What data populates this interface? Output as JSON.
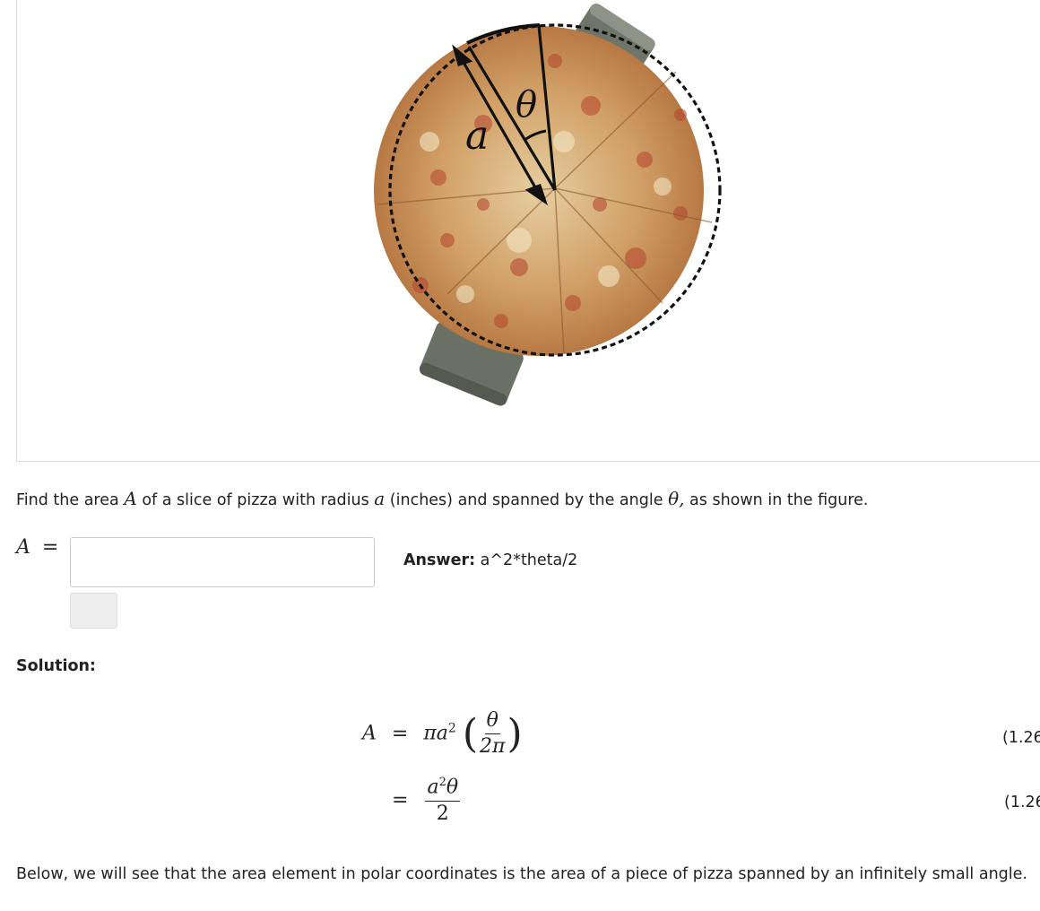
{
  "figure": {
    "label_radius": "a",
    "label_angle": "θ"
  },
  "question": {
    "text_1": "Find the area",
    "var_area": "A",
    "text_2": "of a slice of pizza with radius",
    "var_radius": "a",
    "text_3": "(inches) and spanned by the angle",
    "var_angle": "θ,",
    "text_4": "as shown in the figure."
  },
  "answer_form": {
    "lhs": "A",
    "equals": "=",
    "input_value": "",
    "answer_label": "Answer:",
    "answer_value": "a^2*theta/2"
  },
  "solution": {
    "heading": "Solution:",
    "eq1": {
      "lhs": "A",
      "op": "=",
      "pi_a": "πa",
      "sup": "2",
      "lparen": "(",
      "num": "θ",
      "den": "2π",
      "rparen": ")",
      "number": "(1.26"
    },
    "eq2": {
      "op": "=",
      "num_a": "a",
      "num_sup": "2",
      "num_theta": "θ",
      "den": "2",
      "number": "(1.26"
    },
    "paragraph": "Below, we will see that the area element in polar coordinates is the area of a piece of pizza spanned by an infinitely small angle."
  }
}
